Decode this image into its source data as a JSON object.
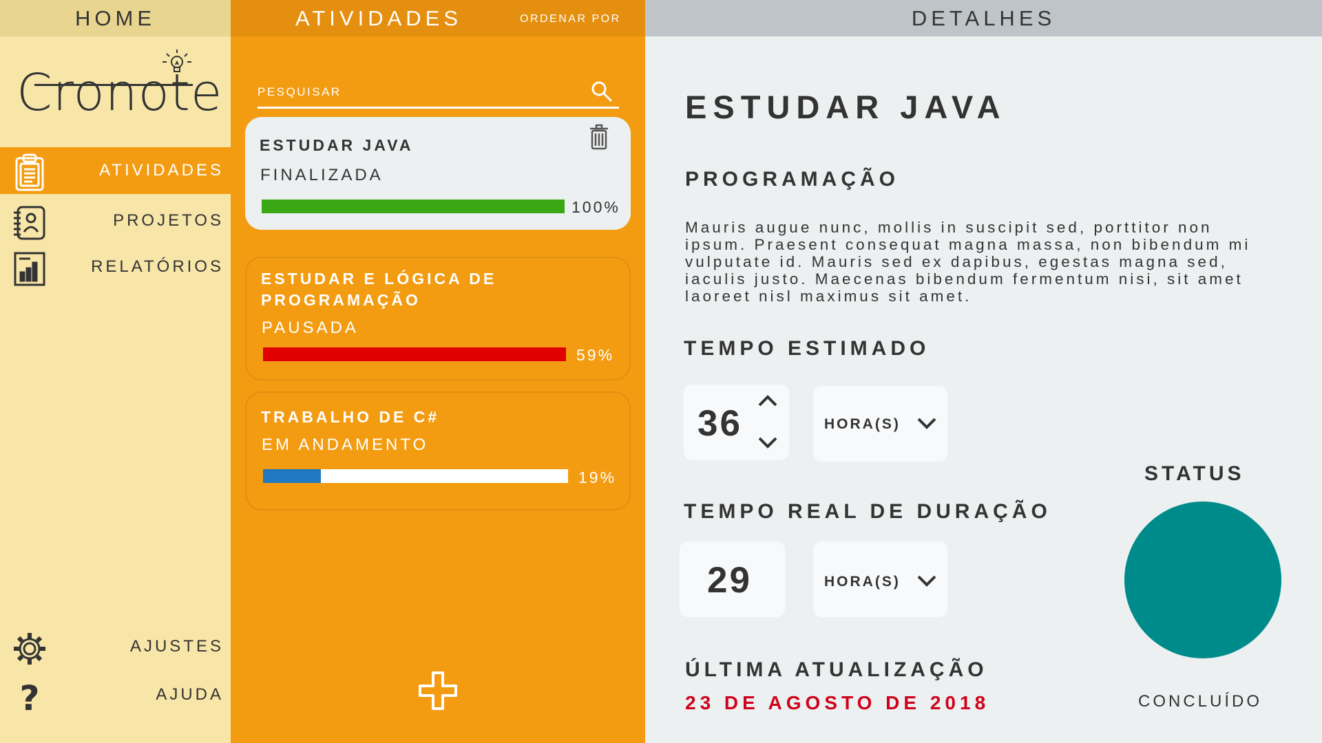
{
  "headers": {
    "home": "HOME",
    "activities": "ATIVIDADES",
    "sort_by": "ORDENAR POR",
    "details": "DETALHES"
  },
  "logo": {
    "text": "Cronote"
  },
  "sidebar": {
    "items": [
      {
        "label": "ATIVIDADES",
        "icon": "clipboard-icon",
        "active": true
      },
      {
        "label": "PROJETOS",
        "icon": "notebook-icon",
        "active": false
      },
      {
        "label": "RELATÓRIOS",
        "icon": "report-chart-icon",
        "active": false
      }
    ],
    "bottom_items": [
      {
        "label": "AJUSTES",
        "icon": "gear-icon"
      },
      {
        "label": "AJUDA",
        "icon": "question-icon"
      }
    ]
  },
  "search": {
    "placeholder": "PESQUISAR"
  },
  "activities": [
    {
      "title": "ESTUDAR JAVA",
      "status": "FINALIZADA",
      "progress": 100,
      "progress_label": "100%",
      "bar_color": "#3aa815",
      "selected": true
    },
    {
      "title_line1": "ESTUDAR  E LÓGICA DE",
      "title_line2": "PROGRAMAÇÃO",
      "status": "PAUSADA",
      "progress": 100,
      "progress_label": "59%",
      "bar_color": "#e00000",
      "selected": false
    },
    {
      "title": "TRABALHO DE C#",
      "status": "EM ANDAMENTO",
      "progress": 19,
      "progress_label": "19%",
      "bar_color": "#1f78c1",
      "selected": false
    }
  ],
  "details": {
    "title": "ESTUDAR JAVA",
    "category": "PROGRAMAÇÃO",
    "description": "Mauris augue nunc, mollis in suscipit sed, porttitor non ipsum. Praesent consequat magna massa, non bibendum mi vulputate id. Mauris sed ex dapibus, egestas magna sed, iaculis justo. Maecenas bibendum fermentum nisi, sit amet laoreet nisl maximus sit amet.",
    "estimated_label": "TEMPO ESTIMADO",
    "estimated_value": "36",
    "estimated_unit": "HORA(S)",
    "real_label": "TEMPO REAL DE DURAÇÃO",
    "real_value": "29",
    "real_unit": "HORA(S)",
    "updated_label": "ÚLTIMA ATUALIZAÇÃO",
    "updated_value": "23 DE AGOSTO DE 2018",
    "status_label": "STATUS",
    "status_value": "CONCLUÍDO",
    "status_color": "#008b8b"
  },
  "colors": {
    "home_bg": "#f7e6a8",
    "activities_bg": "#f39c12",
    "details_bg": "#edf0f1",
    "accent_red": "#d0021b"
  }
}
